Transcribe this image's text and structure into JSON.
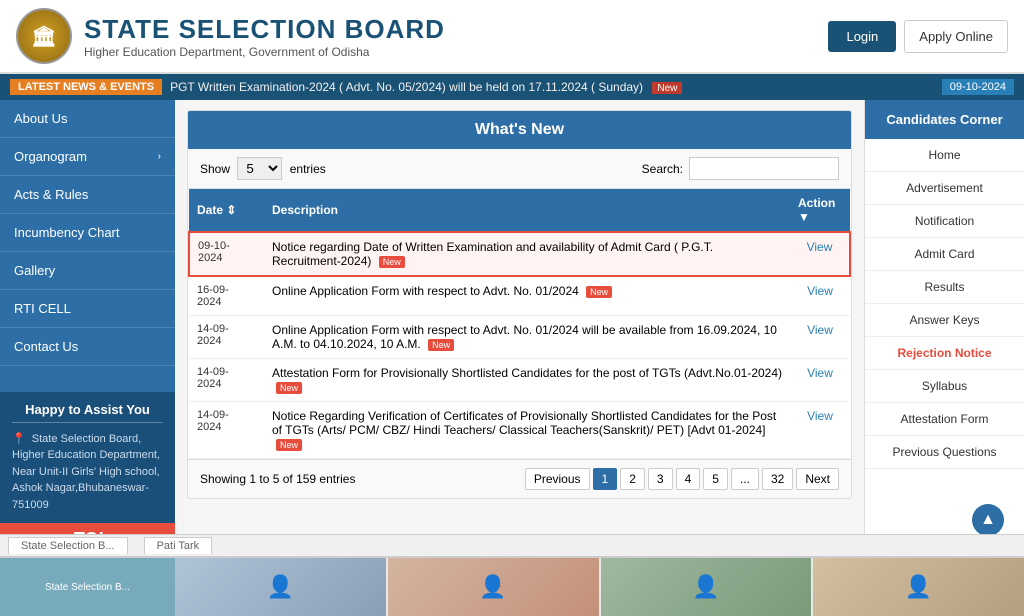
{
  "header": {
    "logo_text": "🏛",
    "title": "STATE SELECTION BOARD",
    "subtitle": "Higher Education Department, Government of Odisha",
    "login_label": "Login",
    "apply_label": "Apply Online"
  },
  "ticker": {
    "label": "LATEST NEWS & EVENTS",
    "text": "PGT Written Examination-2024 ( Advt. No. 05/2024) will be held on 17.11.2024 ( Sunday)",
    "badge": "New",
    "date": "09-10-2024"
  },
  "left_sidebar": {
    "items": [
      {
        "label": "About Us",
        "has_chevron": false
      },
      {
        "label": "Organogram",
        "has_chevron": true
      },
      {
        "label": "Acts & Rules",
        "has_chevron": false
      },
      {
        "label": "Incumbency Chart",
        "has_chevron": false
      },
      {
        "label": "Gallery",
        "has_chevron": false
      },
      {
        "label": "RTI CELL",
        "has_chevron": false
      },
      {
        "label": "Contact Us",
        "has_chevron": false
      }
    ],
    "assist_title": "Happy to Assist You",
    "assist_text": "State Selection Board, Higher Education Department, Near Unit-II Girls' High school, Ashok Nagar,Bhubaneswar-751009"
  },
  "toi": "TOI",
  "main": {
    "title": "What's New",
    "show_label": "Show",
    "entries_label": "entries",
    "show_value": "5",
    "search_label": "Search:",
    "search_value": "",
    "columns": [
      "Date",
      "Description",
      "Action"
    ],
    "rows": [
      {
        "date": "09-10-2024",
        "description": "Notice regarding Date of Written Examination and availability of Admit Card ( P.G.T. Recruitment-2024)",
        "has_badge": true,
        "action": "View",
        "highlighted": true
      },
      {
        "date": "16-09-2024",
        "description": "Online Application Form with respect to Advt. No. 01/2024",
        "has_badge": true,
        "action": "View",
        "highlighted": false
      },
      {
        "date": "14-09-2024",
        "description": "Online Application Form with respect to Advt. No. 01/2024 will be available from 16.09.2024, 10 A.M. to 04.10.2024, 10 A.M.",
        "has_badge": true,
        "action": "View",
        "highlighted": false
      },
      {
        "date": "14-09-2024",
        "description": "Attestation Form for Provisionally Shortlisted Candidates for the post of TGTs (Advt.No.01-2024)",
        "has_badge": true,
        "action": "View",
        "highlighted": false
      },
      {
        "date": "14-09-2024",
        "description": "Notice Regarding Verification of Certificates of Provisionally Shortlisted Candidates for the Post of TGTs (Arts/ PCM/ CBZ/ Hindi Teachers/ Classical Teachers(Sanskrit)/ PET) [Advt 01-2024]",
        "has_badge": true,
        "action": "View",
        "highlighted": false
      }
    ],
    "showing_text": "Showing 1 to 5 of 159 entries",
    "pagination": {
      "prev": "Previous",
      "pages": [
        "1",
        "2",
        "3",
        "4",
        "5",
        "...",
        "32"
      ],
      "next": "Next",
      "active": "1"
    }
  },
  "right_sidebar": {
    "title": "Candidates Corner",
    "items": [
      {
        "label": "Home",
        "highlighted": false
      },
      {
        "label": "Advertisement",
        "highlighted": false
      },
      {
        "label": "Notification",
        "highlighted": false
      },
      {
        "label": "Admit Card",
        "highlighted": false
      },
      {
        "label": "Results",
        "highlighted": false
      },
      {
        "label": "Answer Keys",
        "highlighted": false
      },
      {
        "label": "Rejection Notice",
        "highlighted": true
      },
      {
        "label": "Syllabus",
        "highlighted": false
      },
      {
        "label": "Attestation Form",
        "highlighted": false
      },
      {
        "label": "Previous Questions",
        "highlighted": false
      }
    ]
  },
  "bottom": {
    "map_label": "State Selection B...",
    "tab_label": "Pati Tark"
  },
  "scroll_top": "▲",
  "new_badge_text": "New"
}
